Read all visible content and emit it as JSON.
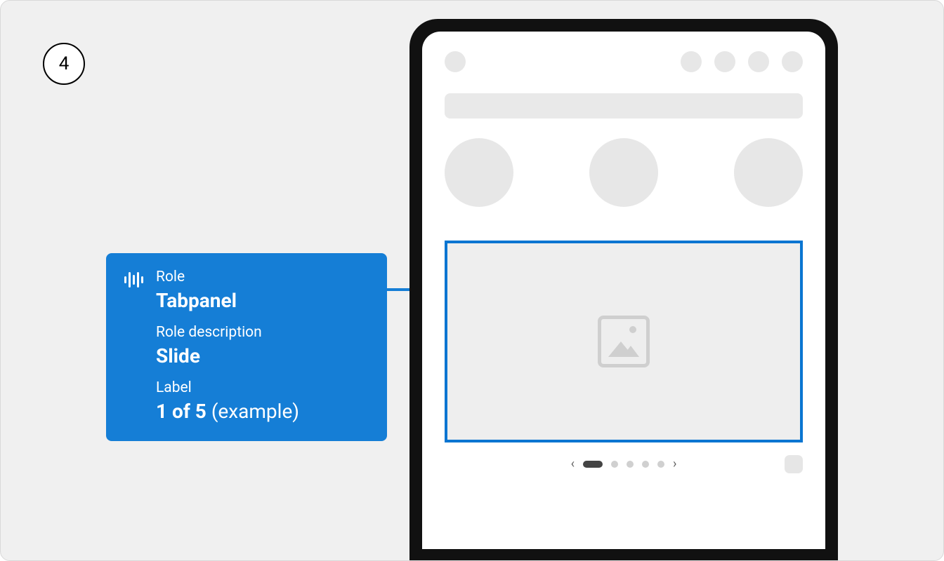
{
  "step_number": "4",
  "callout": {
    "role_label": "Role",
    "role_value": "Tabpanel",
    "role_desc_label": "Role description",
    "role_desc_value": "Slide",
    "label_label": "Label",
    "label_value_bold": "1 of 5",
    "label_value_light": " (example)"
  },
  "carousel": {
    "total_slides": 5,
    "active_slide": 1
  }
}
